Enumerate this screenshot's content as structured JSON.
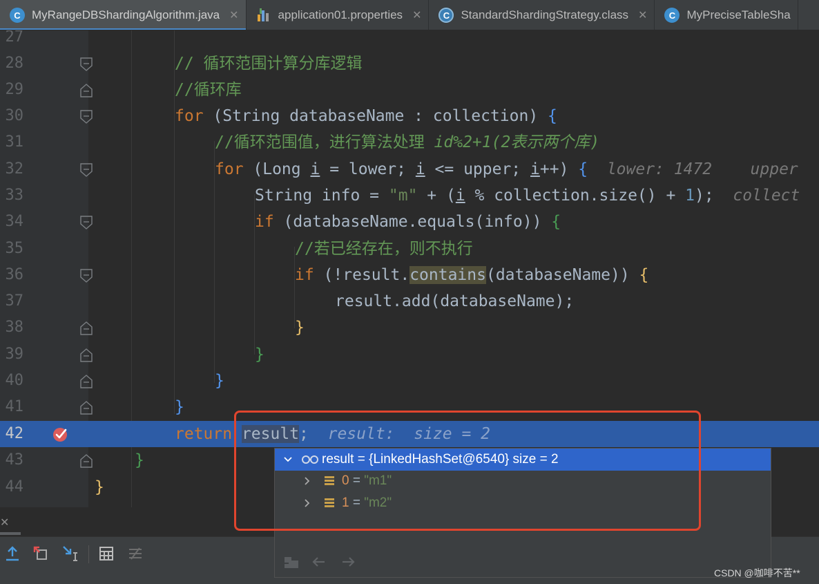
{
  "tabs": [
    {
      "label": "MyRangeDBShardingAlgorithm.java",
      "icon": "class-file-icon",
      "close": "✕",
      "active": true
    },
    {
      "label": "application01.properties",
      "icon": "properties-file-icon",
      "close": "✕",
      "active": false
    },
    {
      "label": "StandardShardingStrategy.class",
      "icon": "compiled-class-icon",
      "close": "✕",
      "active": false
    },
    {
      "label": "MyPreciseTableSha",
      "icon": "class-file-icon",
      "close": "",
      "active": false
    }
  ],
  "tab_icon_letter": "C",
  "editor": {
    "lines": [
      {
        "n": "27"
      },
      {
        "n": "28",
        "c1": "// 循环范围计算分库逻辑"
      },
      {
        "n": "29",
        "c1": "//循环库"
      },
      {
        "n": "30",
        "kw": "for",
        "a": " (String databaseName : collection) ",
        "b": "{"
      },
      {
        "n": "31",
        "c1": "//循环范围值，进行算法处理 ",
        "c2": "id%2+1(2表示两个库)"
      },
      {
        "n": "32",
        "kw": "for",
        "a": " (Long ",
        "i1": "i",
        "a2": " = lower; ",
        "i2": "i",
        "a3": " <= upper; ",
        "i3": "i",
        "a4": "++) ",
        "b": "{",
        "hint": "  lower: 1472    upper"
      },
      {
        "n": "33",
        "a": "String info = ",
        "s": "\"m\"",
        "a2": " + (",
        "i1": "i",
        "a3": " % collection.size() + ",
        "num": "1",
        "a4": ");",
        "hint": "  collect"
      },
      {
        "n": "34",
        "kw": "if",
        "a": " (databaseName.equals(info)) ",
        "b": "{"
      },
      {
        "n": "35",
        "c1": "//若已经存在，则不执行"
      },
      {
        "n": "36",
        "kw": "if",
        "a": " (!result.",
        "hl": "contains",
        "a2": "(databaseName)) ",
        "b": "{"
      },
      {
        "n": "37",
        "a": "result.add(databaseName);"
      },
      {
        "n": "38",
        "b": "}"
      },
      {
        "n": "39",
        "b": "}"
      },
      {
        "n": "40",
        "b": "}"
      },
      {
        "n": "41",
        "b": "}"
      },
      {
        "n": "42",
        "kw": "return",
        "sel": "result",
        "a": ";",
        "hint": "  result:  size = 2"
      },
      {
        "n": "43",
        "b": "}"
      },
      {
        "n": "44",
        "b": "}"
      }
    ]
  },
  "debug_popup": {
    "root": {
      "name": "result",
      "eq": " = ",
      "value": "{LinkedHashSet@6540}",
      "size": "  size = 2"
    },
    "items": [
      {
        "index": "0",
        "eq": " = ",
        "value": "\"m1\""
      },
      {
        "index": "1",
        "eq": " = ",
        "value": "\"m2\""
      }
    ]
  },
  "watermark": "CSDN @咖啡不苦**",
  "colors": {
    "accent": "#4a88c7",
    "selection": "#2f65ca",
    "highlight_box": "#e0452e"
  }
}
